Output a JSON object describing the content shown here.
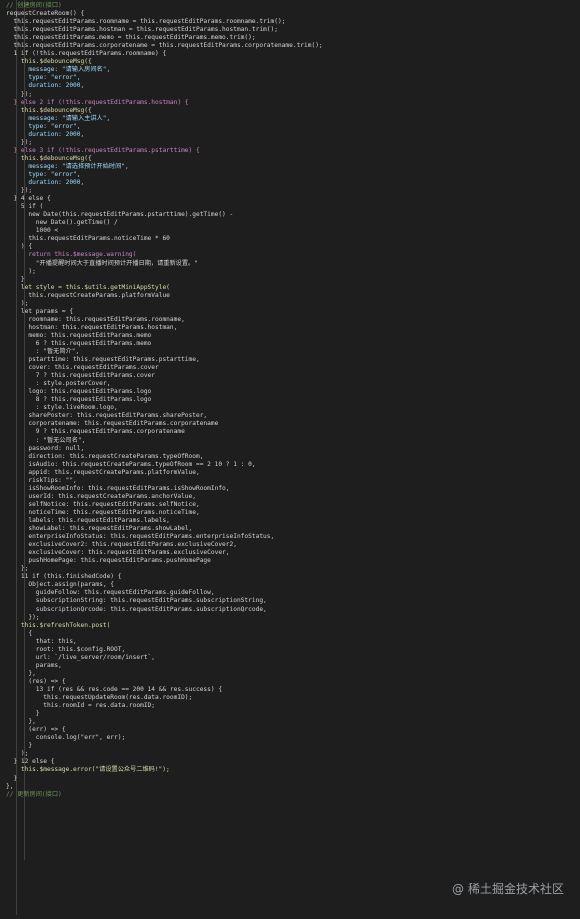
{
  "editor": {
    "lines": [
      "// 创建房间(接口)",
      "requestCreateRoom() {",
      "  this.requestEditParams.roomname = this.requestEditParams.roomname.trim();",
      "  this.requestEditParams.hostman = this.requestEditParams.hostman.trim();",
      "  this.requestEditParams.memo = this.requestEditParams.memo.trim();",
      "  this.requestEditParams.corporatename = this.requestEditParams.corporatename.trim();",
      "  1 if (!this.requestEditParams.roomname) {",
      "    this.$debounceMsg({",
      "      message: \"请输入房间名\",",
      "      type: \"error\",",
      "      duration: 2000,",
      "    });",
      "  } else 2 if (!this.requestEditParams.hostman) {",
      "    this.$debounceMsg({",
      "      message: \"请输入主讲人\",",
      "      type: \"error\",",
      "      duration: 2000,",
      "    });",
      "  } else 3 if (!this.requestEditParams.pstarttime) {",
      "    this.$debounceMsg({",
      "      message: \"请选择预计开始时间\",",
      "      type: \"error\",",
      "      duration: 2000,",
      "    });",
      "  } 4 else {",
      "    5 if (",
      "      new Date(this.requestEditParams.pstarttime).getTime() -",
      "        new Date().getTime() /",
      "        1000 <",
      "      this.requestEditParams.noticeTime * 60",
      "    ) {",
      "      return this.$message.warning(",
      "        \"开播提醒时间大于直播时间预计开播日期，请重新设置。\"",
      "      );",
      "    }",
      "    let style = this.$utils.getMiniAppStyle(",
      "      this.requestCreateParams.platformValue",
      "    );",
      "    let params = {",
      "      roomname: this.requestEditParams.roomname,",
      "      hostman: this.requestEditParams.hostman,",
      "      memo: this.requestEditParams.memo",
      "        6 ? this.requestEditParams.memo",
      "        : \"暂无简介\",",
      "      pstarttime: this.requestEditParams.pstarttime,",
      "      cover: this.requestEditParams.cover",
      "        7 ? this.requestEditParams.cover",
      "        : style.posterCover,",
      "      logo: this.requestEditParams.logo",
      "        8 ? this.requestEditParams.logo",
      "        : style.liveRoom.logo,",
      "      sharePoster: this.requestEditParams.sharePoster,",
      "      corporatename: this.requestEditParams.corporatename",
      "        9 ? this.requestEditParams.corporatename",
      "        : \"暂无公司名\",",
      "      password: null,",
      "      direction: this.requestCreateParams.typeOfRoom,",
      "      isAudio: this.requestCreateParams.typeOfRoom == 2 10 ? 1 : 0,",
      "      appid: this.requestCreateParams.platformValue,",
      "      riskTips: \"\",",
      "      isShowRoomInfo: this.requestEditParams.isShowRoomInfo,",
      "      userId: this.requestCreateParams.anchorValue,",
      "      selfNotice: this.requestEditParams.selfNotice,",
      "      noticeTime: this.requestEditParams.noticeTime,",
      "      labels: this.requestEditParams.labels,",
      "      showLabel: this.requestEditParams.showLabel,",
      "      enterpriseInfoStatus: this.requestEditParams.enterpriseInfoStatus,",
      "      exclusiveCover2: this.requestEditParams.exclusiveCover2,",
      "      exclusiveCover: this.requestEditParams.exclusiveCover,",
      "      pushHomePage: this.requestEditParams.pushHomePage",
      "    };",
      "    11 if (this.finishedCode) {",
      "      Object.assign(params, {",
      "        guideFollow: this.requestEditParams.guideFollow,",
      "        subscriptionString: this.requestEditParams.subscriptionString,",
      "        subscriptionQrcode: this.requestEditParams.subscriptionQrcode,",
      "      });",
      "    this.$refreshToken.post(",
      "      {",
      "        that: this,",
      "        root: this.$config.ROOT,",
      "        url: `/live_server/room/insert`,",
      "        params,",
      "      },",
      "      (res) => {",
      "        13 if (res && res.code == 200 14 && res.success) {",
      "          this.requestUpdateRoom(res.data.roomID);",
      "          this.roomId = res.data.roomID;",
      "        }",
      "      },",
      "      (err) => {",
      "        console.log(\"err\", err);",
      "      }",
      "    );",
      "  } 12 else {",
      "    this.$message.error(\"请设置公众号二维码!\");",
      "  }",
      "},",
      "// 更新房间(接口)"
    ]
  },
  "watermark": {
    "prefix": "@",
    "text": "稀土掘金技术社区"
  },
  "colors": {
    "background": "#1e1e1e",
    "badge": "#d9363e",
    "comment": "#6a9955"
  }
}
